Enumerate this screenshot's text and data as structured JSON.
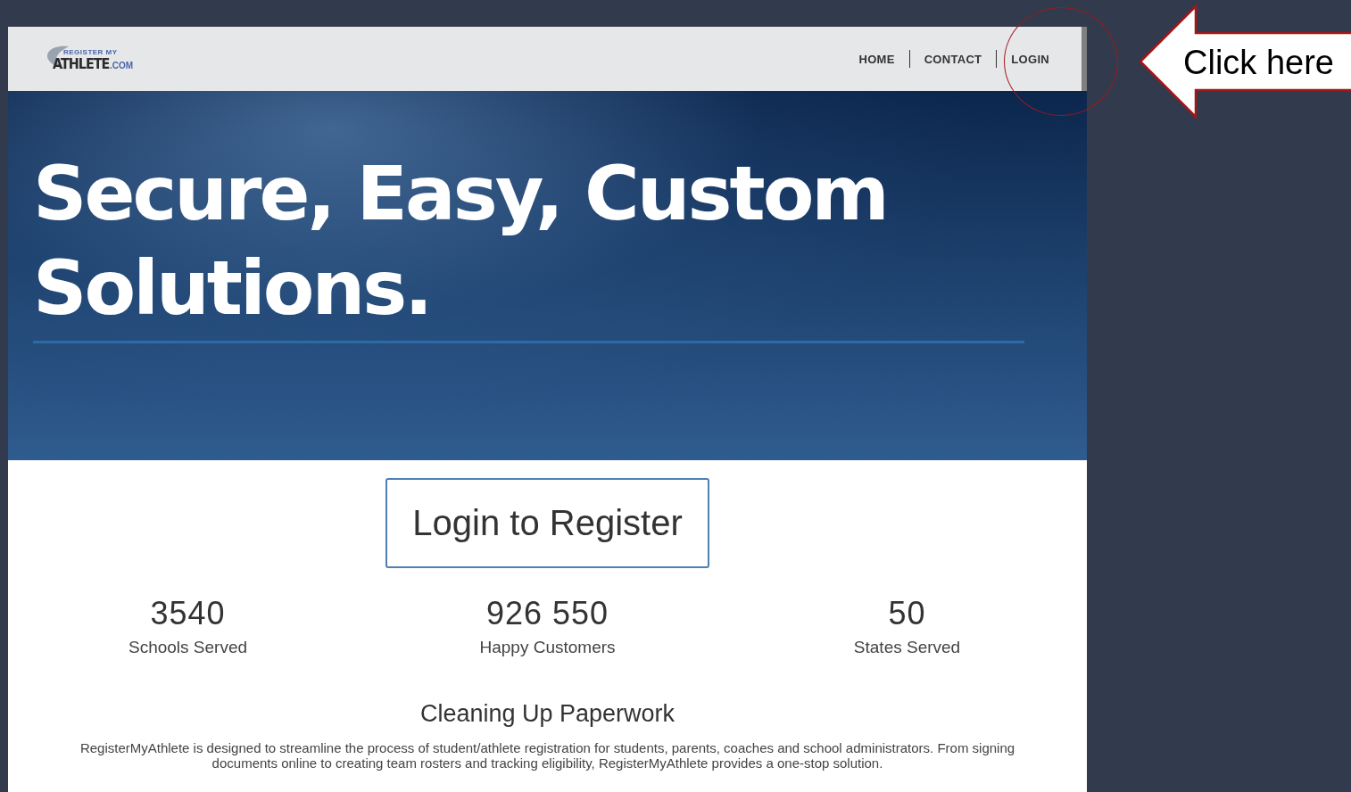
{
  "logo": {
    "top": "REGISTER MY",
    "main": "ATHLETE",
    "suffix": ".COM"
  },
  "nav": [
    {
      "label": "HOME"
    },
    {
      "label": "CONTACT"
    },
    {
      "label": "LOGIN"
    }
  ],
  "hero": {
    "title_lines": [
      "Secure, Easy, Custom",
      "Solutions."
    ]
  },
  "cta": {
    "label": "Login to Register"
  },
  "stats": [
    {
      "value": "3540",
      "label": "Schools Served"
    },
    {
      "value": "926 550",
      "label": "Happy Customers"
    },
    {
      "value": "50",
      "label": "States Served"
    }
  ],
  "section": {
    "heading": "Cleaning Up Paperwork",
    "body": "RegisterMyAthlete is designed to streamline the process of student/athlete registration for students, parents, coaches and school administrators. From signing documents online to creating team rosters and tracking eligibility, RegisterMyAthlete provides a one-stop solution."
  },
  "callout": {
    "text": "Click here"
  }
}
